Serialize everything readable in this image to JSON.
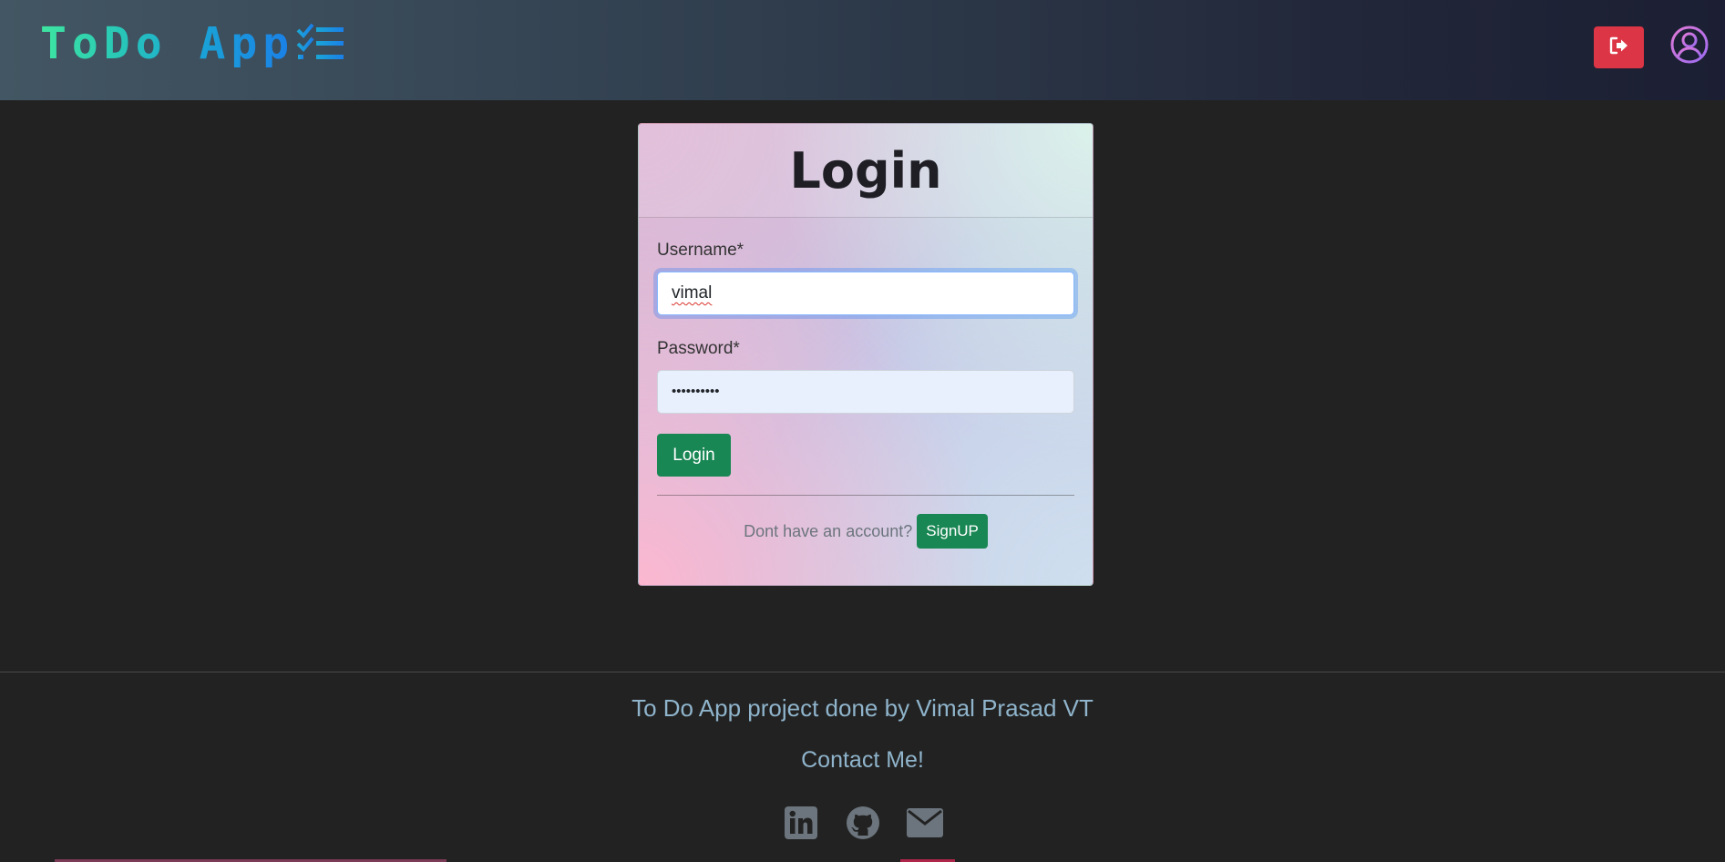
{
  "header": {
    "logo_text": "ToDo App",
    "logout_icon": "logout-icon",
    "profile_icon": "user-circle-icon",
    "colors": {
      "logout_button": "#dc3545",
      "profile_icon": "#c86dd7",
      "logo_gradient_start": "#3ee6a0",
      "logo_gradient_end": "#1a7fe8"
    }
  },
  "login_card": {
    "title": "Login",
    "username": {
      "label": "Username*",
      "value": "vimal"
    },
    "password": {
      "label": "Password*",
      "masked_value": "••••••••••"
    },
    "submit_label": "Login",
    "signup_prompt": "Dont have an account?",
    "signup_label": "SignUP",
    "colors": {
      "primary_button": "#198754"
    }
  },
  "footer": {
    "credit": "To Do App project done by Vimal Prasad VT",
    "contact": "Contact Me!",
    "social_icons": [
      "linkedin-icon",
      "github-icon",
      "email-icon"
    ],
    "colors": {
      "text": "#8fb4cb",
      "icons": "#6c757d"
    }
  }
}
